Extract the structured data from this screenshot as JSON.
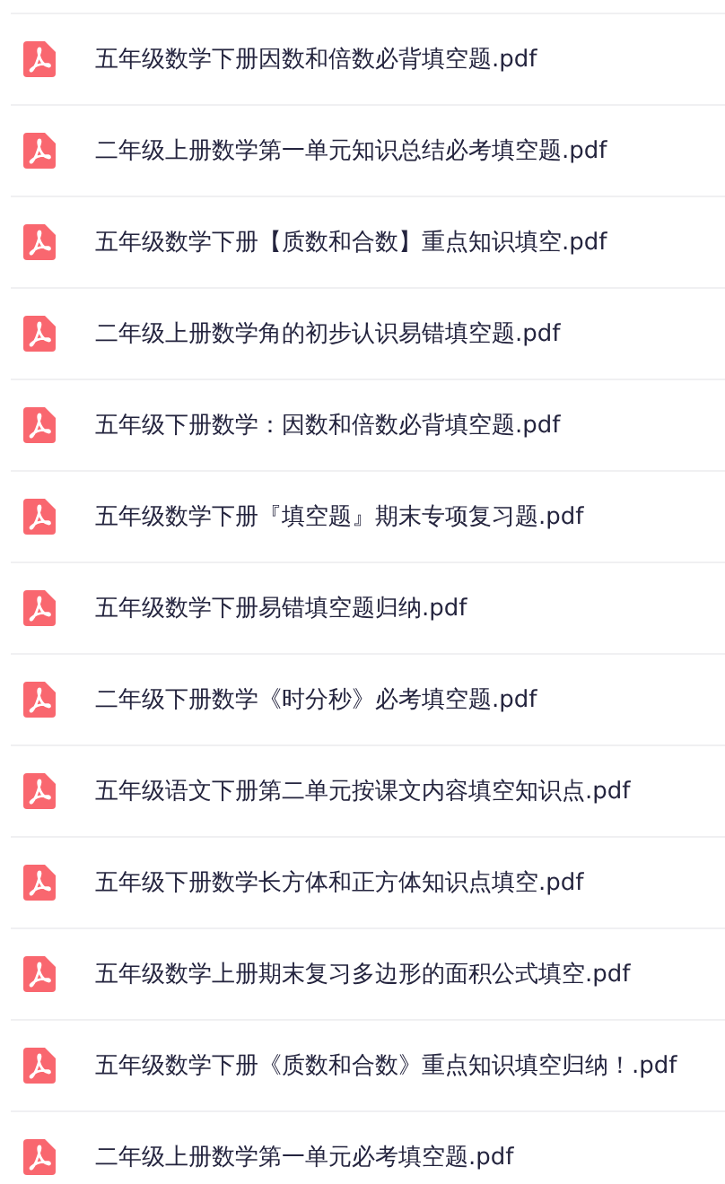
{
  "files": [
    {
      "name": "五年级数学下册因数和倍数必背填空题.pdf",
      "kind": "pdf"
    },
    {
      "name": "二年级上册数学第一单元知识总结必考填空题.pdf",
      "kind": "pdf"
    },
    {
      "name": "五年级数学下册【质数和合数】重点知识填空.pdf",
      "kind": "pdf"
    },
    {
      "name": "二年级上册数学角的初步认识易错填空题.pdf",
      "kind": "pdf"
    },
    {
      "name": "五年级下册数学：因数和倍数必背填空题.pdf",
      "kind": "pdf"
    },
    {
      "name": "五年级数学下册『填空题』期末专项复习题.pdf",
      "kind": "pdf"
    },
    {
      "name": "五年级数学下册易错填空题归纳.pdf",
      "kind": "pdf"
    },
    {
      "name": "二年级下册数学《时分秒》必考填空题.pdf",
      "kind": "pdf"
    },
    {
      "name": "五年级语文下册第二单元按课文内容填空知识点.pdf",
      "kind": "pdf"
    },
    {
      "name": "五年级下册数学长方体和正方体知识点填空.pdf",
      "kind": "pdf"
    },
    {
      "name": "五年级数学上册期末复习多边形的面积公式填空.pdf",
      "kind": "pdf"
    },
    {
      "name": "五年级数学下册《质数和合数》重点知识填空归纳！.pdf",
      "kind": "pdf"
    },
    {
      "name": "二年级上册数学第一单元必考填空题.pdf",
      "kind": "pdf"
    }
  ]
}
